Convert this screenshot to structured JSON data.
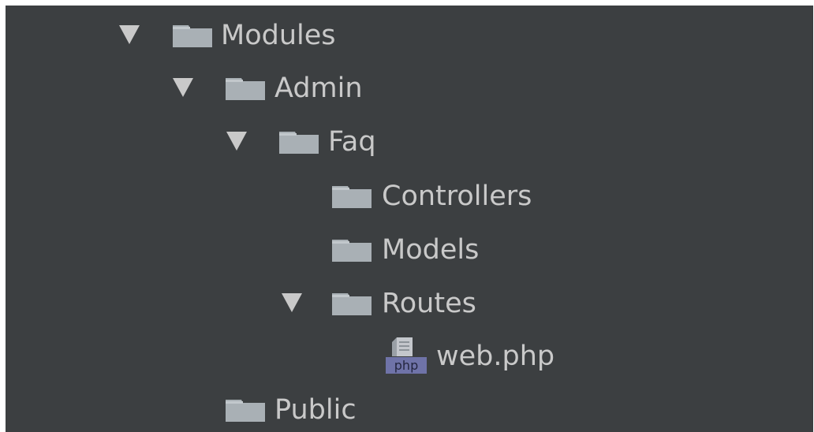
{
  "project_tree": {
    "nodes": [
      {
        "label": "Modules",
        "expanded": true,
        "icon": "folder-icon"
      },
      {
        "label": "Admin",
        "expanded": true,
        "icon": "folder-icon"
      },
      {
        "label": "Faq",
        "expanded": true,
        "icon": "folder-icon"
      },
      {
        "label": "Controllers",
        "expanded": false,
        "icon": "folder-icon"
      },
      {
        "label": "Models",
        "expanded": false,
        "icon": "folder-icon"
      },
      {
        "label": "Routes",
        "expanded": true,
        "icon": "folder-icon"
      },
      {
        "label": "web.php",
        "icon": "php-file-icon",
        "badge": "php"
      },
      {
        "label": "Public",
        "expanded": false,
        "icon": "folder-icon"
      }
    ]
  },
  "colors": {
    "background": "#3c3f41",
    "text": "#c9c9c9",
    "folder": "#a9b0b5",
    "php_badge": "#6f73a8"
  }
}
